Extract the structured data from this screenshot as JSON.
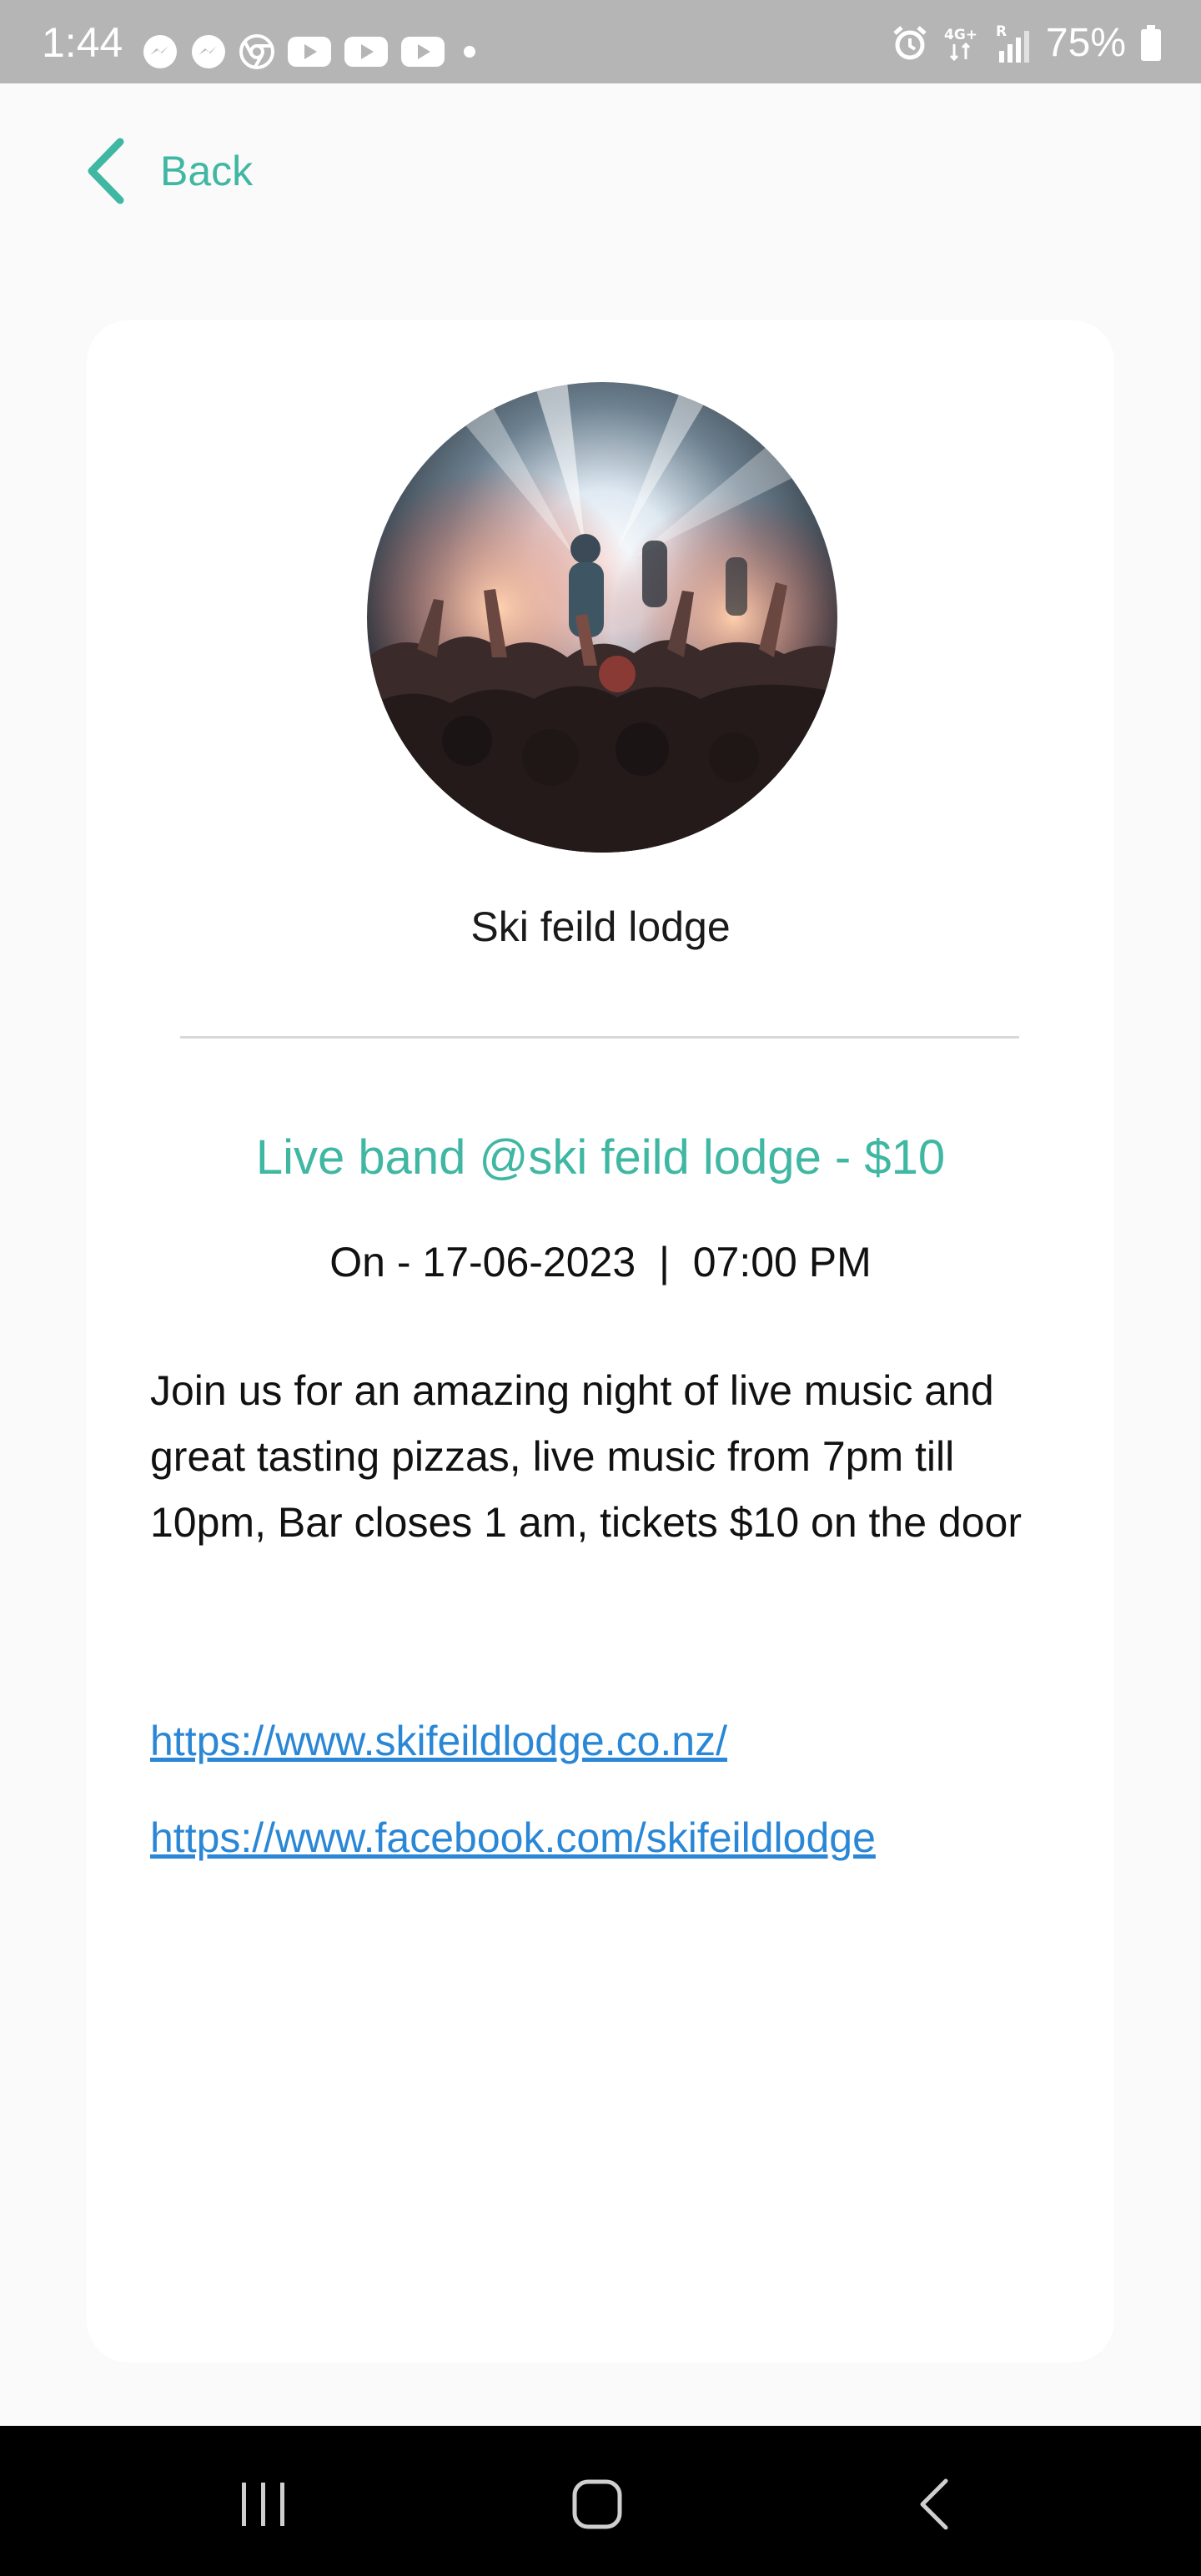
{
  "status_bar": {
    "time": "1:44",
    "battery": "75%",
    "left_icons": [
      "messenger-icon",
      "messenger-icon",
      "chrome-icon",
      "youtube-icon",
      "youtube-icon",
      "youtube-icon",
      "dot-icon"
    ],
    "right_icons": [
      "alarm-icon",
      "network-4g-icon",
      "signal-icon",
      "battery-icon"
    ],
    "background_color": "#b5b5b5"
  },
  "header": {
    "back_label": "Back"
  },
  "venue": {
    "name": "Ski feild lodge",
    "image_icon": "concert-crowd-photo"
  },
  "event": {
    "title": "Live band @ski feild lodge - $10",
    "datetime": "On - 17-06-2023  |  07:00 PM",
    "description": "Join us for an amazing night of live music and great tasting pizzas, live music from 7pm till 10pm, Bar closes 1 am, tickets $10 on the door",
    "links": [
      "https://www.skifeildlodge.co.nz/",
      "https://www.facebook.com/skifeildlodge"
    ]
  },
  "nav_bar": {
    "buttons": [
      "recents-icon",
      "home-icon",
      "back-icon"
    ]
  },
  "colors": {
    "accent": "#3fb7a2",
    "link": "#2a87d6",
    "background": "#fafafa",
    "card": "#ffffff"
  }
}
